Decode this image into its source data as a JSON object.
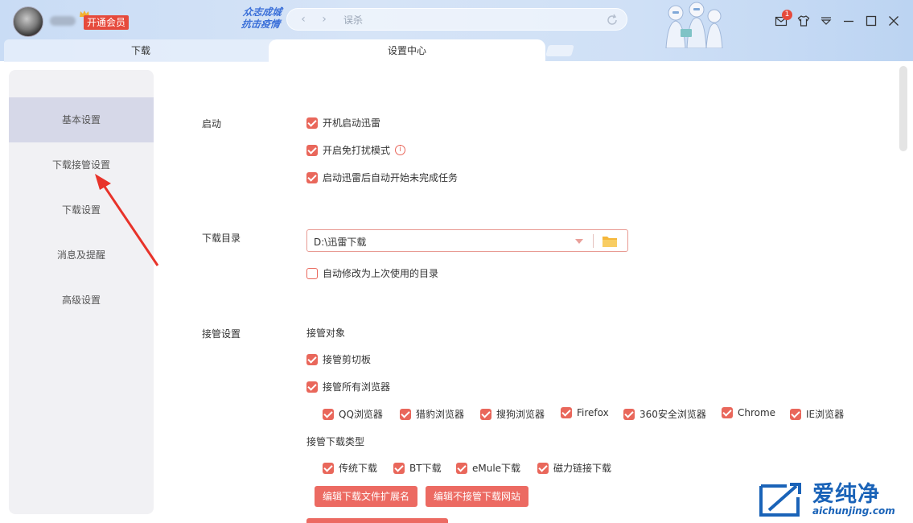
{
  "topbar": {
    "vip_label": "开通会员",
    "slogan_line1": "众志成城",
    "slogan_line2": "抗击疫情",
    "search_text": "误杀",
    "mail_badge": "1"
  },
  "tabs": [
    {
      "label": "下载"
    },
    {
      "label": "设置中心"
    }
  ],
  "sidebar": {
    "items": [
      {
        "label": "基本设置",
        "active": true
      },
      {
        "label": "下载接管设置"
      },
      {
        "label": "下载设置"
      },
      {
        "label": "消息及提醒"
      },
      {
        "label": "高级设置"
      }
    ]
  },
  "startup": {
    "label": "启动",
    "options": [
      {
        "label": "开机启动迅雷",
        "checked": true
      },
      {
        "label": "开启免打扰模式",
        "checked": true
      },
      {
        "label": "启动迅雷后自动开始未完成任务",
        "checked": true
      }
    ]
  },
  "download_dir": {
    "label": "下载目录",
    "value": "D:\\迅雷下载",
    "auto_modify": {
      "label": "自动修改为上次使用的目录",
      "checked": false
    }
  },
  "takeover": {
    "label": "接管设置",
    "target_label": "接管对象",
    "clipboard": {
      "label": "接管剪切板",
      "checked": true
    },
    "all_browsers": {
      "label": "接管所有浏览器",
      "checked": true
    },
    "browsers": [
      {
        "label": "QQ浏览器",
        "checked": true
      },
      {
        "label": "猎豹浏览器",
        "checked": true
      },
      {
        "label": "搜狗浏览器",
        "checked": true
      },
      {
        "label": "Firefox",
        "checked": true
      },
      {
        "label": "360安全浏览器",
        "checked": true
      },
      {
        "label": "Chrome",
        "checked": true
      },
      {
        "label": "IE浏览器",
        "checked": true
      }
    ],
    "types_label": "接管下载类型",
    "types": [
      {
        "label": "传统下载",
        "checked": true
      },
      {
        "label": "BT下载",
        "checked": true
      },
      {
        "label": "eMule下载",
        "checked": true
      },
      {
        "label": "磁力链接下载",
        "checked": true
      }
    ],
    "btn_edit_ext": "编辑下载文件扩展名",
    "btn_edit_sites": "编辑不接管下载网站"
  },
  "watermark": {
    "title": "爱纯净",
    "url": "aichunjing.com"
  },
  "colors": {
    "accent": "#e9675b",
    "button": "#ec6a62",
    "sidebar_bg": "#f1f1f4",
    "sidebar_active": "#d6d8e8",
    "watermark_blue": "#1a63b8"
  }
}
